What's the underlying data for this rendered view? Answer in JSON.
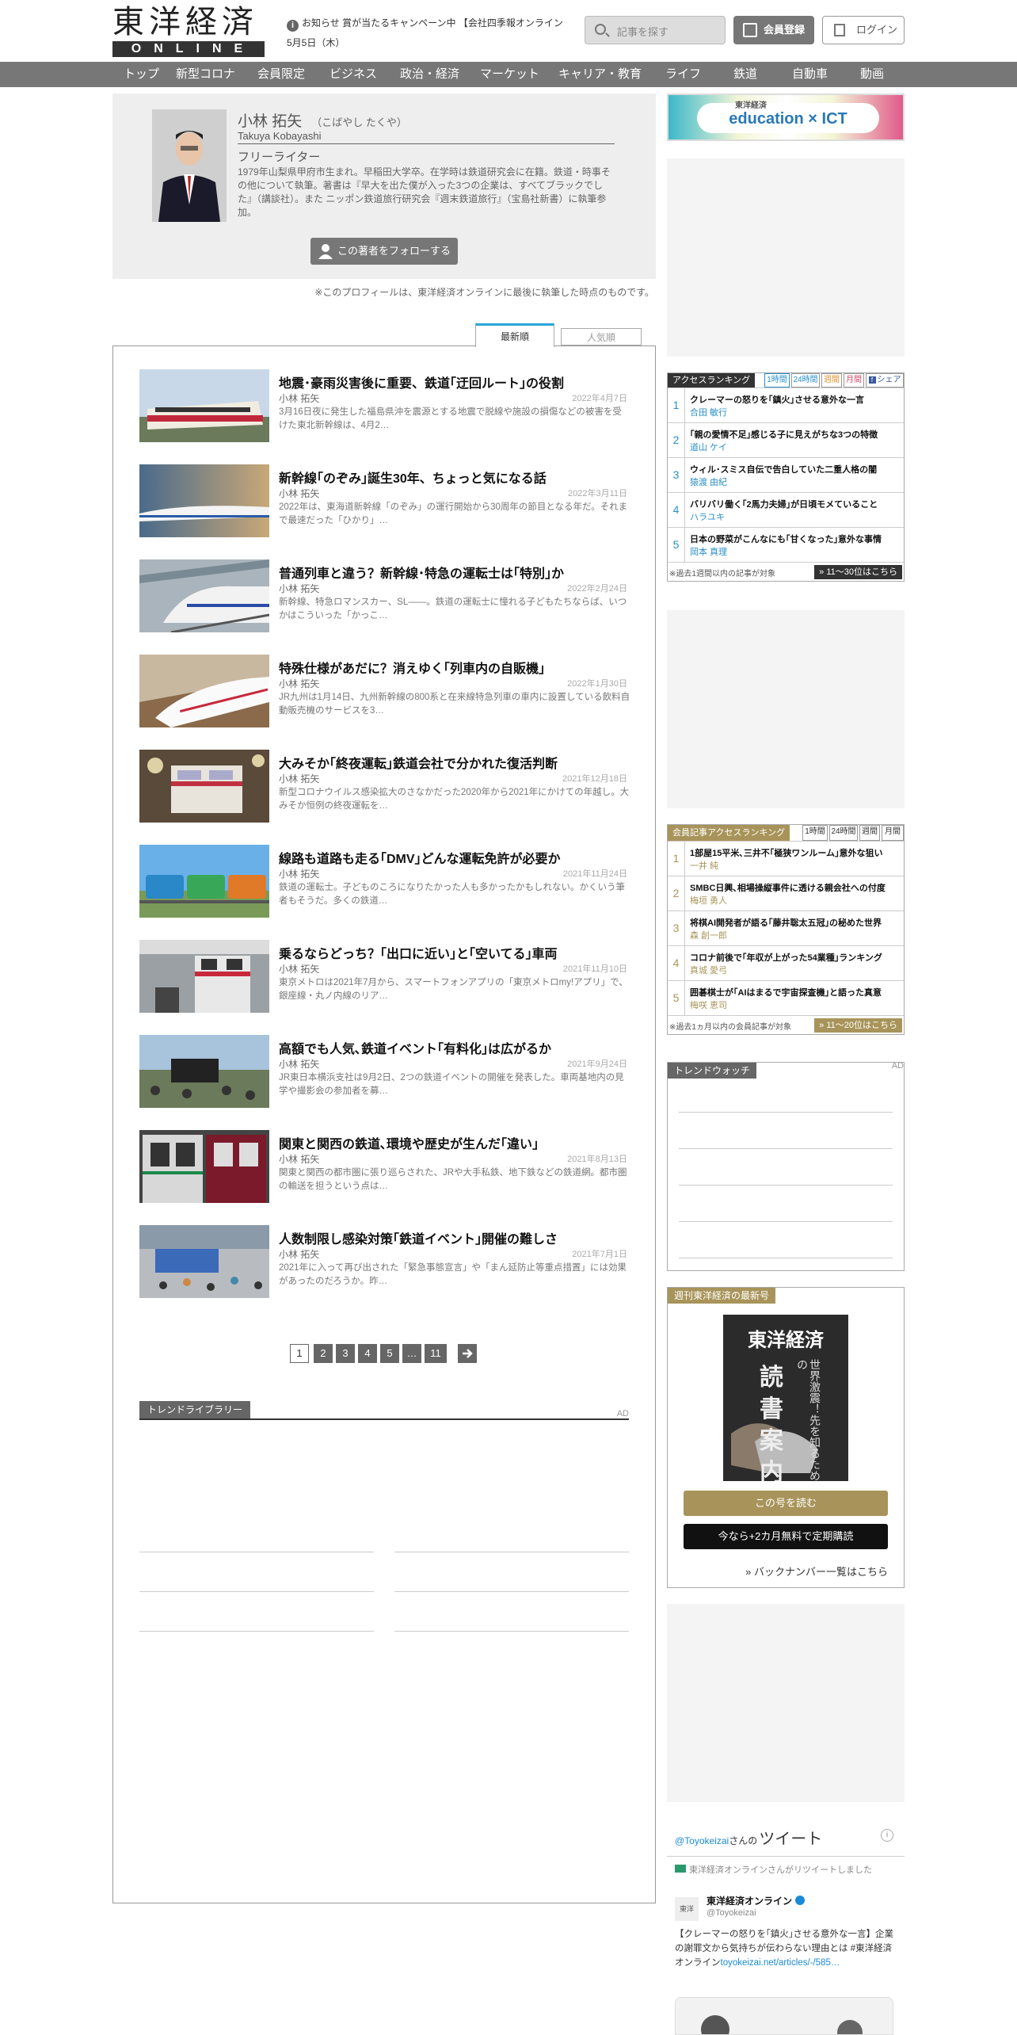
{
  "header": {
    "logo_main": "東洋経済",
    "logo_sub": "ONLINE",
    "notice_icon": "i",
    "notice_text": "お知らせ 賞が当たるキャンペーン中 【会社四季報オンライン",
    "date": "5月5日（木）",
    "search_placeholder": "記事を探す",
    "register_label": "会員登録",
    "login_label": "ログイン"
  },
  "nav": [
    "トップ",
    "新型コロナ",
    "会員限定",
    "ビジネス",
    "政治・経済",
    "マーケット",
    "キャリア・教育",
    "ライフ",
    "鉄道",
    "自動車",
    "動画"
  ],
  "profile": {
    "name": "小林 拓矢",
    "kana": "（こばやし たくや）",
    "name_en": "Takuya Kobayashi",
    "job": "フリーライター",
    "bio": "1979年山梨県甲府市生まれ。早稲田大学卒。在学時は鉄道研究会に在籍。鉄道・時事その他について執筆。著書は『早大を出た僕が入った3つの企業は、すべてブラックでした』（講談社）。また ニッポン鉄道旅行研究会『週末鉄道旅行』（宝島社新書）に執筆参加。",
    "follow_label": "この著者をフォローする",
    "note": "※このプロフィールは、東洋経済オンラインに最後に執筆した時点のものです。"
  },
  "tabs": {
    "latest": "最新順",
    "popular": "人気順"
  },
  "articles": [
    {
      "title": "地震･豪雨災害後に重要、鉄道｢迂回ルート｣の役割",
      "author": "小林 拓矢",
      "date": "2022年4月7日",
      "summary": "3月16日夜に発生した福島県沖を震源とする地震で脱線や施設の損傷などの被害を受けた東北新幹線は、4月2…"
    },
    {
      "title": "新幹線｢のぞみ｣誕生30年、ちょっと気になる話",
      "author": "小林 拓矢",
      "date": "2022年3月11日",
      "summary": "2022年は、東海道新幹線「のぞみ」の運行開始から30周年の節目となる年だ。それまで最速だった「ひかり」…"
    },
    {
      "title": "普通列車と違う？新幹線･特急の運転士は｢特別｣か",
      "author": "小林 拓矢",
      "date": "2022年2月24日",
      "summary": "新幹線、特急ロマンスカー、SL――。鉄道の運転士に憧れる子どもたちならば、いつかはこういった「かっこ…"
    },
    {
      "title": "特殊仕様があだに？消えゆく｢列車内の自販機｣",
      "author": "小林 拓矢",
      "date": "2022年1月30日",
      "summary": "JR九州は1月14日、九州新幹線の800系と在来線特急列車の車内に設置している飲料自動販売機のサービスを3…"
    },
    {
      "title": "大みそか｢終夜運転｣鉄道会社で分かれた復活判断",
      "author": "小林 拓矢",
      "date": "2021年12月18日",
      "summary": "新型コロナウイルス感染拡大のさなかだった2020年から2021年にかけての年越し。大みそか恒例の終夜運転を…"
    },
    {
      "title": "線路も道路も走る｢DMV｣どんな運転免許が必要か",
      "author": "小林 拓矢",
      "date": "2021年11月24日",
      "summary": "鉄道の運転士。子どものころになりたかった人も多かったかもしれない。かくいう筆者もそうだ。多くの鉄道…"
    },
    {
      "title": "乗るならどっち？｢出口に近い｣と｢空いてる｣車両",
      "author": "小林 拓矢",
      "date": "2021年11月10日",
      "summary": "東京メトロは2021年7月から、スマートフォンアプリの「東京メトロmy!アプリ」で、銀座線・丸ノ内線のリア…"
    },
    {
      "title": "高額でも人気､鉄道イベント｢有料化｣は広がるか",
      "author": "小林 拓矢",
      "date": "2021年9月24日",
      "summary": "JR東日本横浜支社は9月2日、2つの鉄道イベントの開催を発表した。車両基地内の見学や撮影会の参加者を募…"
    },
    {
      "title": "関東と関西の鉄道､環境や歴史が生んだ｢違い｣",
      "author": "小林 拓矢",
      "date": "2021年8月13日",
      "summary": "関東と関西の都市圏に張り巡らされた、JRや大手私鉄、地下鉄などの鉄道網。都市圏の輸送を担うという点は…"
    },
    {
      "title": "人数制限し感染対策｢鉄道イベント｣開催の難しさ",
      "author": "小林 拓矢",
      "date": "2021年7月1日",
      "summary": "2021年に入って再び出された「緊急事態宣言」や「まん延防止等重点措置」には効果があったのだろうか。昨…"
    }
  ],
  "pager": [
    "1",
    "2",
    "3",
    "4",
    "5",
    "…",
    "11"
  ],
  "trend_library": {
    "label": "トレンドライブラリー",
    "ad": "AD"
  },
  "sidebar": {
    "banner_top": "東洋経済",
    "banner_text": "education × ICT",
    "ranking": {
      "label": "アクセスランキング",
      "tabs": [
        "1時間",
        "24時間",
        "週間",
        "月間",
        "シェア"
      ],
      "items": [
        {
          "n": "1",
          "title": "クレーマーの怒りを｢鎮火｣させる意外な一言",
          "author": "合田 敏行"
        },
        {
          "n": "2",
          "title": "｢親の愛情不足｣感じる子に見えがちな3つの特徴",
          "author": "道山 ケイ"
        },
        {
          "n": "3",
          "title": "ウィル･スミス自伝で告白していた二重人格の闇",
          "author": "猿渡 由紀"
        },
        {
          "n": "4",
          "title": "バリバリ働く｢2馬力夫婦｣が日頃モメていること",
          "author": "ハラユキ"
        },
        {
          "n": "5",
          "title": "日本の野菜がこんなにも｢甘くなった｣意外な事情",
          "author": "岡本 真理"
        }
      ],
      "foot": "※過去1週間以内の記事が対象",
      "more": "» 11～30位はこちら"
    },
    "member_ranking": {
      "label": "会員記事アクセスランキング",
      "tabs": [
        "1時間",
        "24時間",
        "週間",
        "月間"
      ],
      "items": [
        {
          "n": "1",
          "title": "1部屋15平米､三井不｢極狭ワンルーム｣意外な狙い",
          "author": "一井 純"
        },
        {
          "n": "2",
          "title": "SMBC日興､相場操縦事件に透ける親会社への付度",
          "author": "梅垣 勇人"
        },
        {
          "n": "3",
          "title": "将棋AI開発者が語る｢藤井聡太五冠｣の秘めた世界",
          "author": "森 創一郎"
        },
        {
          "n": "4",
          "title": "コロナ前後で｢年収が上がった54業種｣ランキング",
          "author": "真城 愛弓"
        },
        {
          "n": "5",
          "title": "囲碁棋士が｢AIはまるで宇宙探査機｣と語った真意",
          "author": "梅咲 恵司"
        }
      ],
      "foot": "※過去1ヵ月以内の会員記事が対象",
      "more": "» 11～20位はこちら"
    },
    "trend_watch": {
      "label": "トレンドウォッチ",
      "ad": "AD"
    },
    "weekly": {
      "label": "週刊東洋経済の最新号",
      "mast": "東洋経済",
      "cover_big": "読書案内",
      "cover_v": "世界激震！先を知るための",
      "read_label": "この号を読む",
      "sub_label": "今なら+2カ月無料で定期購読",
      "back_label": "» バックナンバー一覧はこちら"
    },
    "twitter": {
      "handle": "@Toyokeizai",
      "handle_suffix": "さんの",
      "title": "ツイート",
      "rt": "東洋経済オンラインさんがリツイートしました",
      "account": "東洋経済オンライン",
      "account_handle": "@Toyokeizai",
      "body": "【クレーマーの怒りを｢鎮火｣させる意外な一言】企業の謝罪文から気持ちが伝わらない理由とは #東洋経済オンライン",
      "link": "toyokeizai.net/articles/-/585…"
    }
  },
  "colors": {
    "accent": "#2aa6d8",
    "gold": "#a8945a",
    "nav": "#777777"
  }
}
